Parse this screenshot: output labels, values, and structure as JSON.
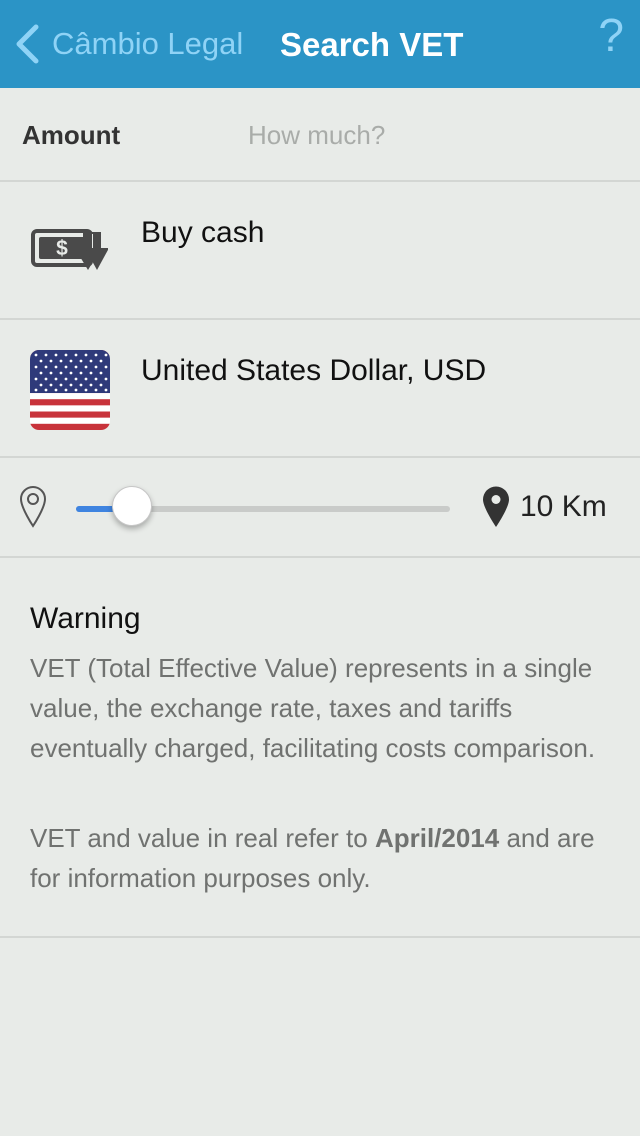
{
  "nav": {
    "back_label": "Câmbio Legal",
    "title": "Search VET",
    "help_label": "?"
  },
  "amount": {
    "label": "Amount",
    "placeholder": "How much?",
    "value": ""
  },
  "operation": {
    "label": "Buy cash",
    "icon": "buy-cash-icon"
  },
  "currency": {
    "label": "United States Dollar, USD",
    "icon": "us-flag-icon"
  },
  "distance": {
    "value_label": "10 Km",
    "slider_fraction": 0.15
  },
  "warning": {
    "title": "Warning",
    "body": "VET (Total Effective Value) represents in a single value, the exchange rate, taxes and tariffs eventually charged, facilitating costs comparison.",
    "note_prefix": "VET and value in real refer to ",
    "note_date": "April/2014",
    "note_suffix": " and are for information purposes only."
  },
  "colors": {
    "navbar": "#2b94c6",
    "back_accent": "#8fd3f6",
    "slider_fill": "#3f84e0",
    "background": "#e8ebe8"
  }
}
